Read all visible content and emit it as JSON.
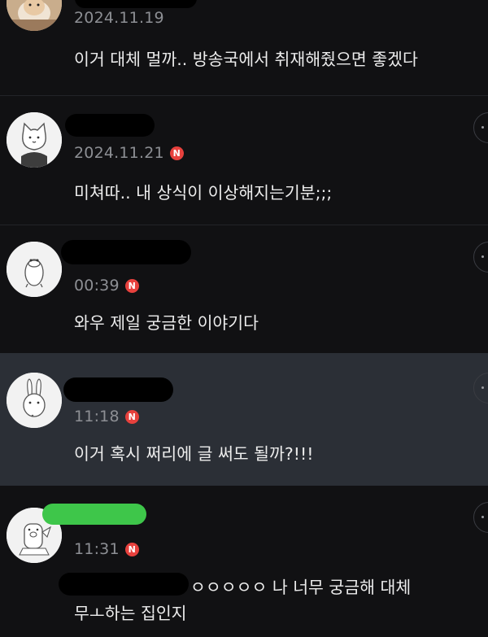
{
  "comments": [
    {
      "avatar": "hamster-photo-avatar",
      "username": "",
      "timestamp": "2024.11.19",
      "has_badge": false,
      "text": "이거 대체 멀까.. 방송국에서 취재해줬으면 좋겠다"
    },
    {
      "avatar": "cat-character-avatar",
      "username": "",
      "timestamp": "2024.11.21",
      "has_badge": true,
      "badge": "N",
      "text": "미쳐따.. 내 상식이 이상해지는기분;;;"
    },
    {
      "avatar": "duck-character-avatar",
      "username": "",
      "timestamp": "00:39",
      "has_badge": true,
      "badge": "N",
      "text": "와우 제일 궁금한 이야기다"
    },
    {
      "avatar": "rabbit-character-avatar",
      "username": "",
      "timestamp": "11:18",
      "has_badge": true,
      "badge": "N",
      "text": "이거 혹시 쩌리에 글 써도 될까?!!!",
      "highlighted": true
    },
    {
      "avatar": "pig-character-avatar",
      "username": "",
      "timestamp": "11:31",
      "has_badge": true,
      "badge": "N",
      "text_line1": "ㅇㅇㅇㅇㅇ 나 너무 궁금해 대체",
      "text_line2": "무ㅗ하는 집인지"
    }
  ],
  "colors": {
    "background": "#111113",
    "highlight_background": "#2b2f36",
    "badge": "#e7413d",
    "redaction": "#000000",
    "redaction_green": "#3ec64a",
    "text": "#ececec",
    "meta": "#8d8f94"
  }
}
